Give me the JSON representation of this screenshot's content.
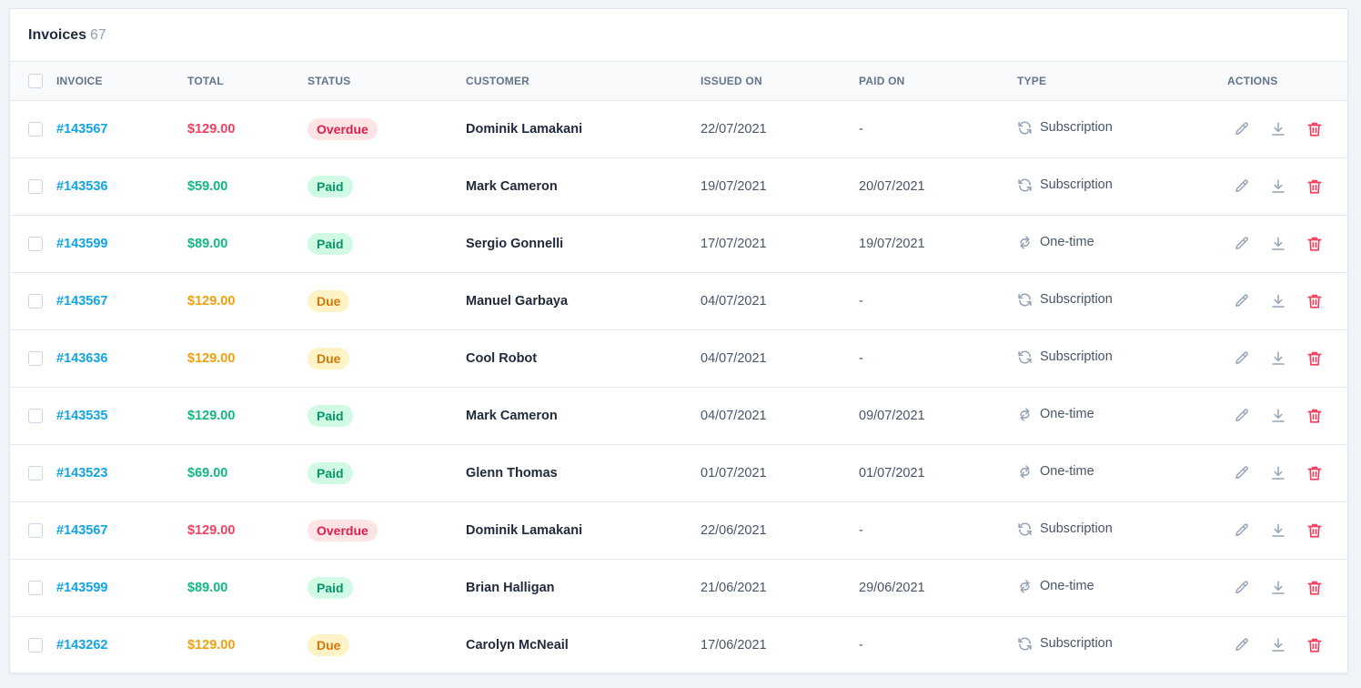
{
  "header": {
    "title": "Invoices",
    "count": "67"
  },
  "columns": {
    "invoice": "Invoice",
    "total": "Total",
    "status": "Status",
    "customer": "Customer",
    "issued_on": "Issued on",
    "paid_on": "Paid on",
    "type": "Type",
    "actions": "Actions"
  },
  "colors": {
    "link": "#0ea5e9",
    "overdue": "#f43f5e",
    "paid": "#10b981",
    "due": "#f59e0b",
    "icon": "#94a3b8",
    "delete": "#f43f5e"
  },
  "rows": [
    {
      "invoice": "#143567",
      "total": "$129.00",
      "status": "Overdue",
      "status_key": "overdue",
      "customer": "Dominik Lamakani",
      "issued_on": "22/07/2021",
      "paid_on": "-",
      "type": "Subscription",
      "type_icon": "refresh-icon"
    },
    {
      "invoice": "#143536",
      "total": "$59.00",
      "status": "Paid",
      "status_key": "paid",
      "customer": "Mark Cameron",
      "issued_on": "19/07/2021",
      "paid_on": "20/07/2021",
      "type": "Subscription",
      "type_icon": "refresh-icon"
    },
    {
      "invoice": "#143599",
      "total": "$89.00",
      "status": "Paid",
      "status_key": "paid",
      "customer": "Sergio Gonnelli",
      "issued_on": "17/07/2021",
      "paid_on": "19/07/2021",
      "type": "One-time",
      "type_icon": "transfer-icon"
    },
    {
      "invoice": "#143567",
      "total": "$129.00",
      "status": "Due",
      "status_key": "due",
      "customer": "Manuel Garbaya",
      "issued_on": "04/07/2021",
      "paid_on": "-",
      "type": "Subscription",
      "type_icon": "refresh-icon"
    },
    {
      "invoice": "#143636",
      "total": "$129.00",
      "status": "Due",
      "status_key": "due",
      "customer": "Cool Robot",
      "issued_on": "04/07/2021",
      "paid_on": "-",
      "type": "Subscription",
      "type_icon": "refresh-icon"
    },
    {
      "invoice": "#143535",
      "total": "$129.00",
      "status": "Paid",
      "status_key": "paid",
      "customer": "Mark Cameron",
      "issued_on": "04/07/2021",
      "paid_on": "09/07/2021",
      "type": "One-time",
      "type_icon": "transfer-icon"
    },
    {
      "invoice": "#143523",
      "total": "$69.00",
      "status": "Paid",
      "status_key": "paid",
      "customer": "Glenn Thomas",
      "issued_on": "01/07/2021",
      "paid_on": "01/07/2021",
      "type": "One-time",
      "type_icon": "transfer-icon"
    },
    {
      "invoice": "#143567",
      "total": "$129.00",
      "status": "Overdue",
      "status_key": "overdue",
      "customer": "Dominik Lamakani",
      "issued_on": "22/06/2021",
      "paid_on": "-",
      "type": "Subscription",
      "type_icon": "refresh-icon"
    },
    {
      "invoice": "#143599",
      "total": "$89.00",
      "status": "Paid",
      "status_key": "paid",
      "customer": "Brian Halligan",
      "issued_on": "21/06/2021",
      "paid_on": "29/06/2021",
      "type": "One-time",
      "type_icon": "transfer-icon"
    },
    {
      "invoice": "#143262",
      "total": "$129.00",
      "status": "Due",
      "status_key": "due",
      "customer": "Carolyn McNeail",
      "issued_on": "17/06/2021",
      "paid_on": "-",
      "type": "Subscription",
      "type_icon": "refresh-icon"
    }
  ]
}
